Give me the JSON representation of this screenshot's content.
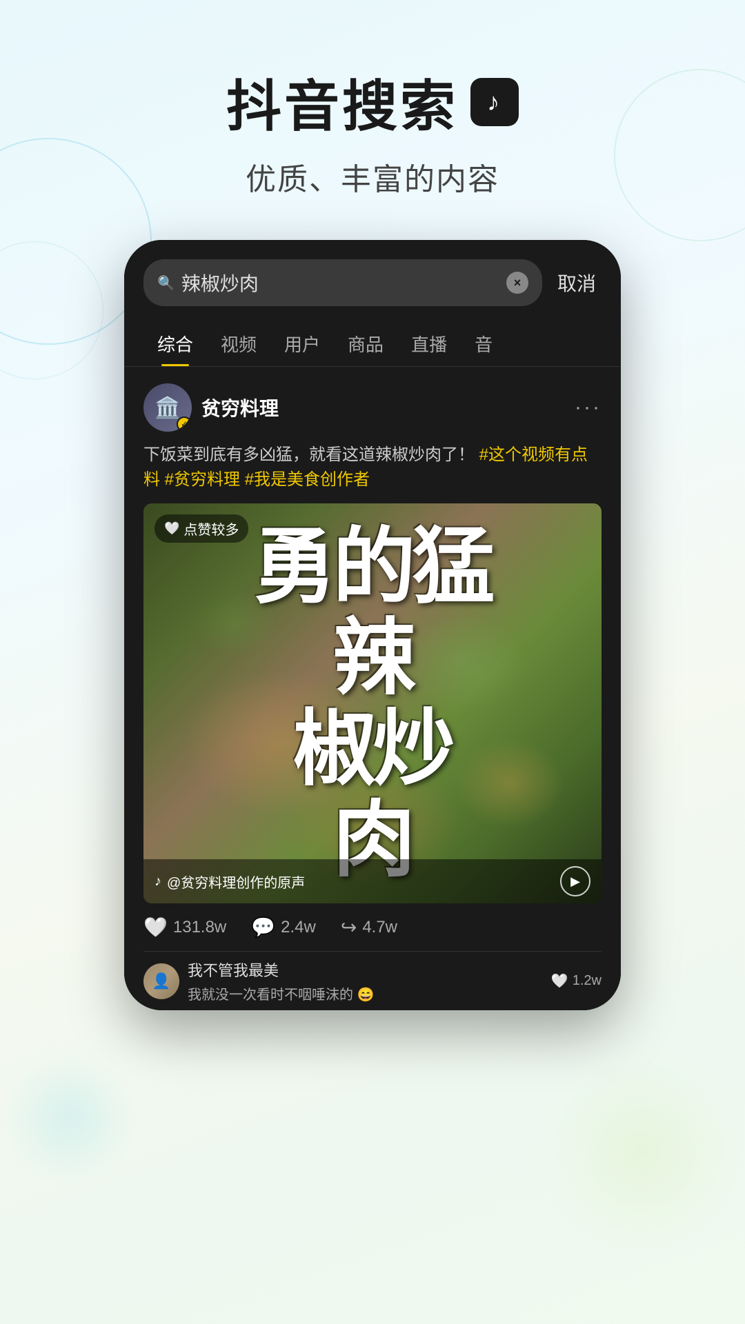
{
  "header": {
    "main_title": "抖音搜索",
    "subtitle": "优质、丰富的内容"
  },
  "search": {
    "query": "辣椒炒肉",
    "cancel_label": "取消",
    "clear_icon": "×"
  },
  "tabs": [
    {
      "label": "综合",
      "active": true
    },
    {
      "label": "视频",
      "active": false
    },
    {
      "label": "用户",
      "active": false
    },
    {
      "label": "商品",
      "active": false
    },
    {
      "label": "直播",
      "active": false
    },
    {
      "label": "音",
      "active": false
    }
  ],
  "post": {
    "username": "贫穷料理",
    "verified": true,
    "description": "下饭菜到底有多凶猛，就看这道辣椒炒肉了！",
    "hashtags": [
      "#这个视频有点料",
      "#贫穷料理",
      "#我是美食创作者"
    ],
    "likes_badge": "点赞较多",
    "video_text": "勇\n的猛\n辣\n椒炒\n肉",
    "audio_text": "@贫穷料理创作的原声",
    "interactions": {
      "likes": "131.8w",
      "comments": "2.4w",
      "shares": "4.7w"
    },
    "comments": [
      {
        "username": "我不管我最美",
        "text": "我就没一次看时不咽唾沫的 😄",
        "likes": "1.2w"
      }
    ]
  }
}
